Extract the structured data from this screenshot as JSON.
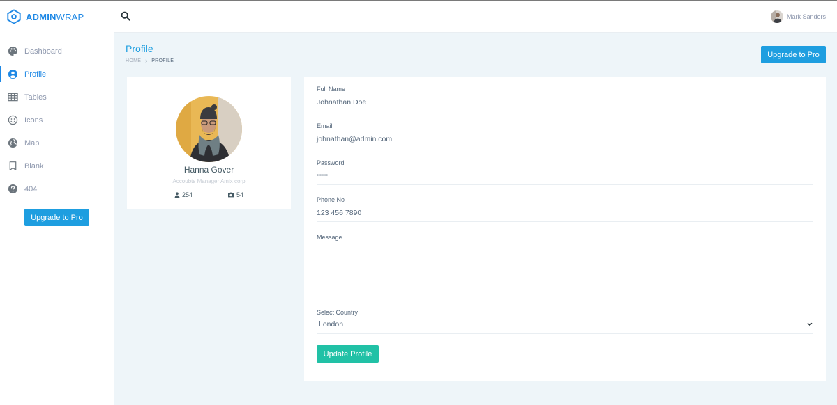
{
  "brand": {
    "strong": "ADMIN",
    "light": "WRAP",
    "color": "#1e88e5"
  },
  "sidebar": {
    "items": [
      {
        "label": "Dashboard",
        "icon": "palette-icon",
        "active": false
      },
      {
        "label": "Profile",
        "icon": "user-circle-icon",
        "active": true
      },
      {
        "label": "Tables",
        "icon": "table-icon",
        "active": false
      },
      {
        "label": "Icons",
        "icon": "smile-icon",
        "active": false
      },
      {
        "label": "Map",
        "icon": "globe-icon",
        "active": false
      },
      {
        "label": "Blank",
        "icon": "bookmark-icon",
        "active": false
      },
      {
        "label": "404",
        "icon": "question-circle-icon",
        "active": false
      }
    ],
    "upgrade_label": "Upgrade to Pro"
  },
  "topbar": {
    "user_name": "Mark Sanders",
    "search_icon": "search-icon"
  },
  "page": {
    "title": "Profile",
    "breadcrumb": {
      "home": "HOME",
      "current": "PROFILE"
    },
    "upgrade_label": "Upgrade to Pro"
  },
  "profile": {
    "name": "Hanna Gover",
    "role": "Accoubts Manager Amix corp",
    "followers": "254",
    "photos": "54"
  },
  "form": {
    "full_name": {
      "label": "Full Name",
      "value": "Johnathan Doe"
    },
    "email": {
      "label": "Email",
      "value": "johnathan@admin.com"
    },
    "password": {
      "label": "Password",
      "value": "••••••••"
    },
    "phone": {
      "label": "Phone No",
      "value": "123 456 7890"
    },
    "message": {
      "label": "Message",
      "value": ""
    },
    "country": {
      "label": "Select Country",
      "value": "London"
    },
    "submit_label": "Update Profile"
  },
  "colors": {
    "primary": "#1e9ee0",
    "success": "#21c1a6",
    "background": "#eef5f9"
  }
}
